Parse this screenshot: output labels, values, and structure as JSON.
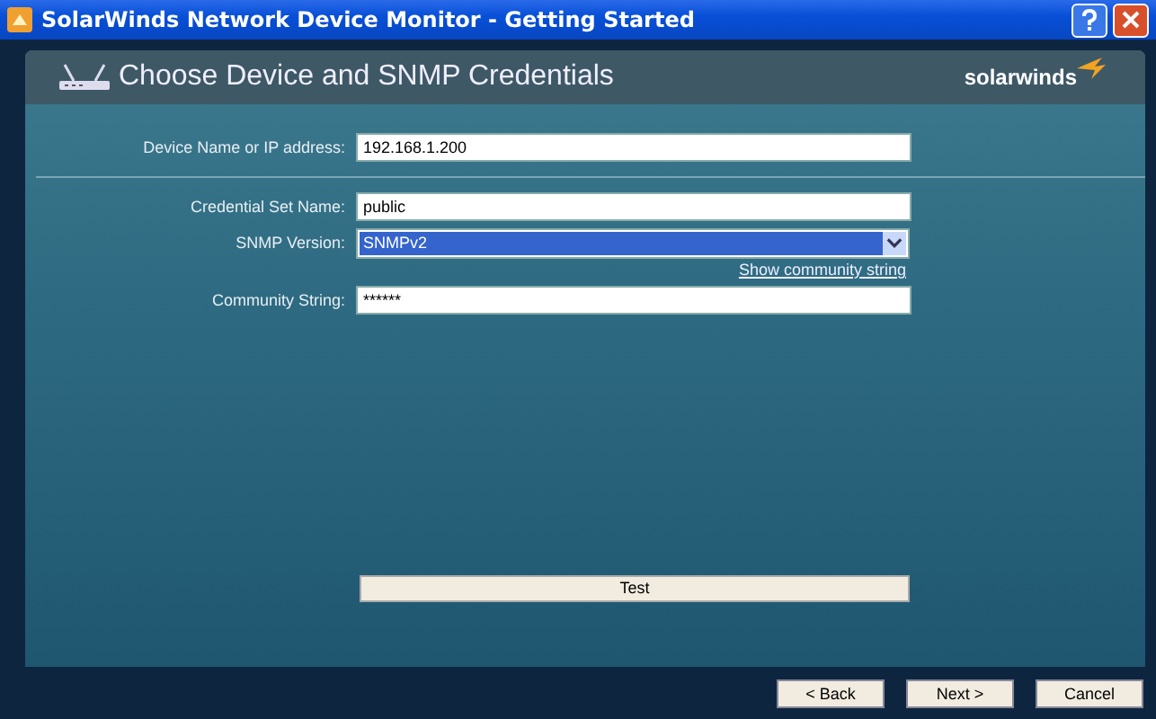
{
  "window": {
    "title": "SolarWinds Network Device Monitor - Getting Started"
  },
  "header": {
    "title": "Choose Device and SNMP Credentials",
    "logo": "solarwinds"
  },
  "device_field": {
    "label": "Device Name or IP address:",
    "value": "192.168.1.200"
  },
  "credential_fields": [
    {
      "kind": "text",
      "label": "Credential Set Name:",
      "value": "public"
    },
    {
      "kind": "select",
      "label": "SNMP Version:",
      "value": "SNMPv2",
      "focused": true
    },
    {
      "kind": "link",
      "text": "Show community string"
    },
    {
      "kind": "password",
      "label": "Community String:",
      "value": "******"
    }
  ],
  "test_button": "Test",
  "nav_buttons": [
    {
      "label": "< Back"
    },
    {
      "label": "Next >"
    },
    {
      "label": "Cancel"
    }
  ]
}
